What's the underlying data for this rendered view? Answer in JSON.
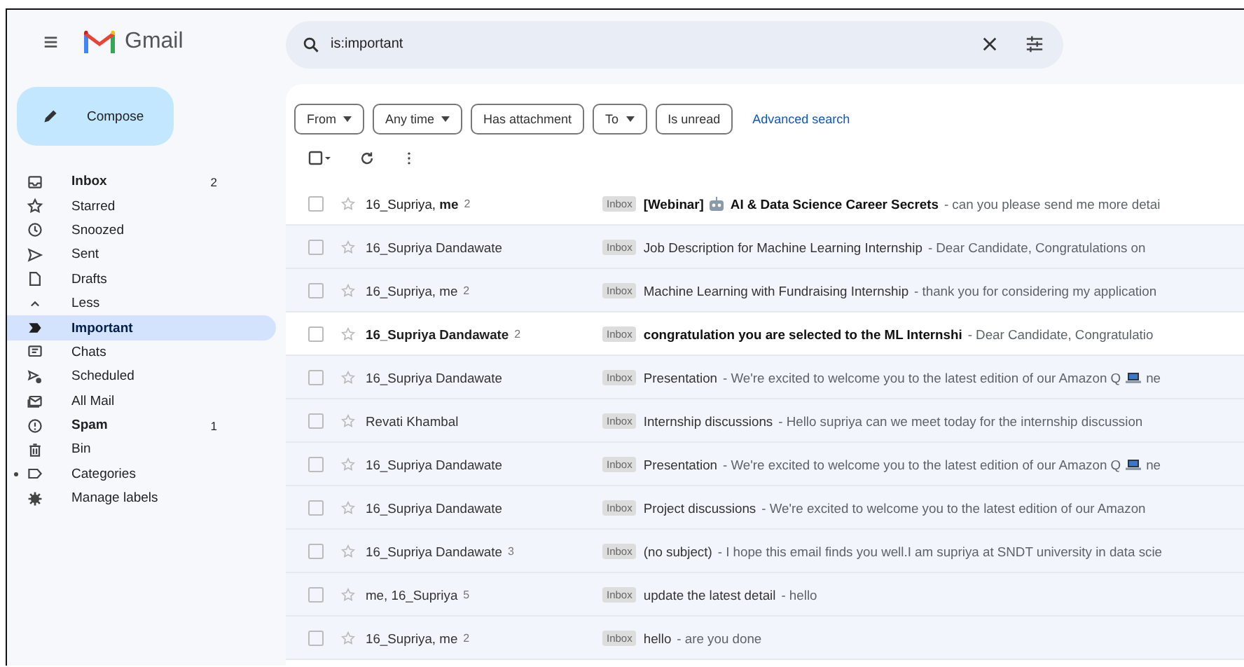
{
  "header": {
    "menu": "≡",
    "app_name": "Gmail"
  },
  "compose": {
    "label": "Compose"
  },
  "sidebar": {
    "items": [
      {
        "kind": "inbox",
        "label": "Inbox",
        "count": "2",
        "bold": true,
        "selected": false
      },
      {
        "kind": "star",
        "label": "Starred",
        "bold": false,
        "selected": false
      },
      {
        "kind": "clock",
        "label": "Snoozed",
        "bold": false,
        "selected": false
      },
      {
        "kind": "send",
        "label": "Sent",
        "bold": false,
        "selected": false
      },
      {
        "kind": "draft",
        "label": "Drafts",
        "bold": false,
        "selected": false
      },
      {
        "kind": "less",
        "label": "Less",
        "bold": false,
        "selected": false
      },
      {
        "kind": "important",
        "label": "Important",
        "bold": true,
        "selected": true
      },
      {
        "kind": "chat",
        "label": "Chats",
        "bold": false,
        "selected": false
      },
      {
        "kind": "scheduled",
        "label": "Scheduled",
        "bold": false,
        "selected": false
      },
      {
        "kind": "allmail",
        "label": "All Mail",
        "bold": false,
        "selected": false
      },
      {
        "kind": "spam",
        "label": "Spam",
        "count": "1",
        "bold": true,
        "selected": false
      },
      {
        "kind": "bin",
        "label": "Bin",
        "bold": false,
        "selected": false
      },
      {
        "kind": "label",
        "label": "Categories",
        "bold": false,
        "selected": false
      },
      {
        "kind": "gear",
        "label": "Manage labels",
        "bold": false,
        "selected": false
      }
    ]
  },
  "search": {
    "value": "is:important"
  },
  "filters": [
    {
      "label": "From",
      "dropdown": true
    },
    {
      "label": "Any time",
      "dropdown": true
    },
    {
      "label": "Has attachment",
      "dropdown": false
    },
    {
      "label": "To",
      "dropdown": true
    },
    {
      "label": "Is unread",
      "dropdown": false
    }
  ],
  "advanced_search": "Advanced search",
  "select_all": {
    "checked": false
  },
  "messages": [
    {
      "sender": "16_Supriya, **me**",
      "sender_bold": false,
      "count": "2",
      "unread": true,
      "label": "Inbox",
      "subject": "[Webinar]",
      "subject_rest": "AI & Data Science Career Secrets",
      "snippet": "- can you please send me more detai"
    },
    {
      "sender": "16_Supriya Dandawate",
      "sender_bold": false,
      "unread": false,
      "label": "Inbox",
      "subject": "Job Description for Machine Learning Internship",
      "snippet": "- Dear Candidate, Congratulations on"
    },
    {
      "sender": "16_Supriya, me",
      "sender_bold": false,
      "count": "2",
      "unread": false,
      "label": "Inbox",
      "subject": "Machine Learning with Fundraising Internship",
      "snippet": "- thank you for considering my application"
    },
    {
      "sender": "16_Supriya Dandawate",
      "sender_bold": true,
      "count": "2",
      "unread": true,
      "label": "Inbox",
      "subject": "congratulation you are selected to the ML Internshi",
      "snippet": "- Dear Candidate, Congratulatio"
    },
    {
      "sender": "16_Supriya Dandawate",
      "sender_bold": false,
      "unread": false,
      "label": "Inbox",
      "subject": "Presentation",
      "snippet": "- We're excited to welcome you to the latest edition of our Amazon Q",
      "snippet_rest": "ne"
    },
    {
      "sender": "Revati Khambal",
      "sender_bold": false,
      "unread": false,
      "label": "Inbox",
      "subject": "Internship discussions",
      "snippet": "- Hello supriya can we meet today for the internship discussion"
    },
    {
      "sender": "16_Supriya Dandawate",
      "sender_bold": false,
      "unread": false,
      "label": "Inbox",
      "subject": "Presentation",
      "snippet": "- We're excited to welcome you to the latest edition of our Amazon Q",
      "snippet_rest": "ne"
    },
    {
      "sender": "16_Supriya Dandawate",
      "sender_bold": false,
      "unread": false,
      "label": "Inbox",
      "subject": "Project discussions",
      "snippet": "- We're excited to welcome you to the latest edition of our Amazon"
    },
    {
      "sender": "16_Supriya Dandawate",
      "sender_bold": false,
      "count": "3",
      "unread": false,
      "label": "Inbox",
      "subject": "(no subject)",
      "snippet": "- I hope this email finds you well.I am supriya at SNDT university in data scie"
    },
    {
      "sender": "me, 16_Supriya",
      "sender_bold": false,
      "count": "5",
      "unread": false,
      "label": "Inbox",
      "subject": "update the latest detail",
      "snippet": "- hello"
    },
    {
      "sender": "16_Supriya, me",
      "sender_bold": false,
      "count": "2",
      "unread": false,
      "label": "Inbox",
      "subject": "hello",
      "snippet": "- are you done"
    }
  ]
}
